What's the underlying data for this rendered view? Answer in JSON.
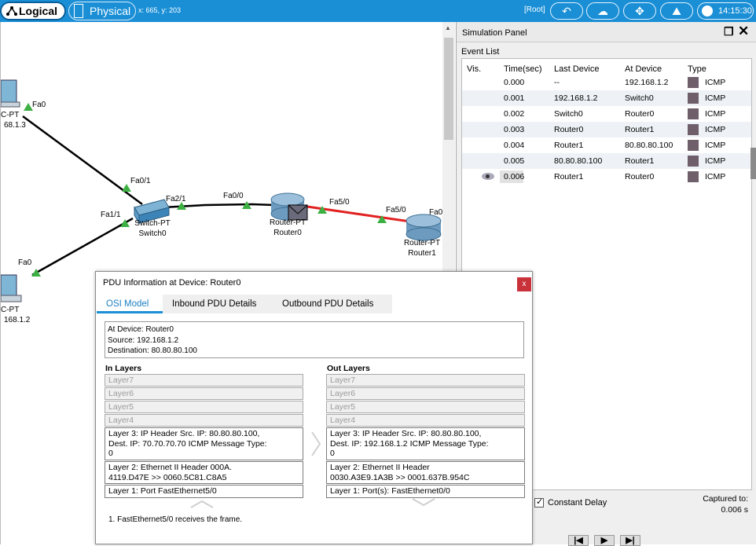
{
  "topbar": {
    "logical_label": "Logical",
    "physical_label": "Physical",
    "coords": "x: 665, y: 203",
    "root_label": "[Root]",
    "clock": "14:15:30",
    "nav_buttons": [
      "back-icon",
      "cloud-settings-icon",
      "move-icon",
      "landscape-icon"
    ]
  },
  "topology": {
    "links": [
      {
        "from_label": "Fa0",
        "to_label": "Fa0/1"
      },
      {
        "from_label": "Fa0",
        "to_label": "Fa1/1"
      },
      {
        "from_label": "Fa2/1",
        "to_label": "Fa0/0"
      },
      {
        "from_label": "Fa5/0",
        "to_label": "Fa0"
      }
    ],
    "port_labels": {
      "pc_top_fa0": "Fa0",
      "switch_fa01": "Fa0/1",
      "switch_fa21": "Fa2/1",
      "router0_fa00": "Fa0/0",
      "router0_fa50": "Fa5/0",
      "router1_fa50": "Fa5/0",
      "router1_fa0": "Fa0",
      "switch_fa11": "Fa1/1",
      "pc_bottom_fa0": "Fa0"
    },
    "devices": {
      "pc_top": {
        "model": "C-PT",
        "ip": "68.1.3"
      },
      "switch": {
        "model": "Switch-PT",
        "name": "Switch0"
      },
      "router0": {
        "model": "Router-PT",
        "name": "Router0"
      },
      "router1": {
        "model": "Router-PT",
        "name": "Router1"
      },
      "pc_bottom": {
        "model": "C-PT",
        "ip": "168.1.2"
      }
    }
  },
  "simulation": {
    "title": "Simulation Panel",
    "event_list_label": "Event List",
    "columns": [
      "Vis.",
      "Time(sec)",
      "Last Device",
      "At Device",
      "Type"
    ],
    "events": [
      {
        "time": "0.000",
        "last": "--",
        "at": "192.168.1.2",
        "type": "ICMP",
        "visible": false
      },
      {
        "time": "0.001",
        "last": "192.168.1.2",
        "at": "Switch0",
        "type": "ICMP",
        "visible": false
      },
      {
        "time": "0.002",
        "last": "Switch0",
        "at": "Router0",
        "type": "ICMP",
        "visible": false
      },
      {
        "time": "0.003",
        "last": "Router0",
        "at": "Router1",
        "type": "ICMP",
        "visible": false
      },
      {
        "time": "0.004",
        "last": "Router1",
        "at": "80.80.80.100",
        "type": "ICMP",
        "visible": false
      },
      {
        "time": "0.005",
        "last": "80.80.80.100",
        "at": "Router1",
        "type": "ICMP",
        "visible": false
      },
      {
        "time": "0.006",
        "last": "Router1",
        "at": "Router0",
        "type": "ICMP",
        "visible": true
      }
    ],
    "type_color": "#6e5f6b",
    "constant_delay_label": "Constant Delay",
    "constant_delay_checked": true,
    "captured_label": "Captured to:",
    "captured_value": "0.006 s"
  },
  "pdu": {
    "title": "PDU Information at Device: Router0",
    "close_label": "x",
    "tabs": [
      "OSI Model",
      "Inbound PDU Details",
      "Outbound PDU Details"
    ],
    "active_tab": "OSI Model",
    "info_device": "At Device: Router0",
    "info_source": "Source: 192.168.1.2",
    "info_dest": "Destination: 80.80.80.100",
    "in_layers_label": "In Layers",
    "out_layers_label": "Out Layers",
    "in_layers": {
      "l7": "Layer7",
      "l6": "Layer6",
      "l5": "Layer5",
      "l4": "Layer4",
      "l3a": "Layer 3: IP Header Src. IP: 80.80.80.100,",
      "l3b": "Dest. IP: 70.70.70.70 ICMP Message Type:",
      "l3c": "0",
      "l2a": "Layer 2: Ethernet II Header 000A.",
      "l2b": "4119.D47E >> 0060.5C81.C8A5",
      "l1": "Layer 1: Port FastEthernet5/0"
    },
    "out_layers": {
      "l7": "Layer7",
      "l6": "Layer6",
      "l5": "Layer5",
      "l4": "Layer4",
      "l3a": "Layer 3: IP Header Src. IP: 80.80.80.100,",
      "l3b": "Dest. IP: 192.168.1.2 ICMP Message Type:",
      "l3c": "0",
      "l2a": "Layer 2: Ethernet II Header",
      "l2b": "0030.A3E9.1A3B >> 0001.637B.954C",
      "l1": "Layer 1: Port(s): FastEthernet0/0"
    },
    "note": "1. FastEthernet5/0 receives the frame."
  }
}
